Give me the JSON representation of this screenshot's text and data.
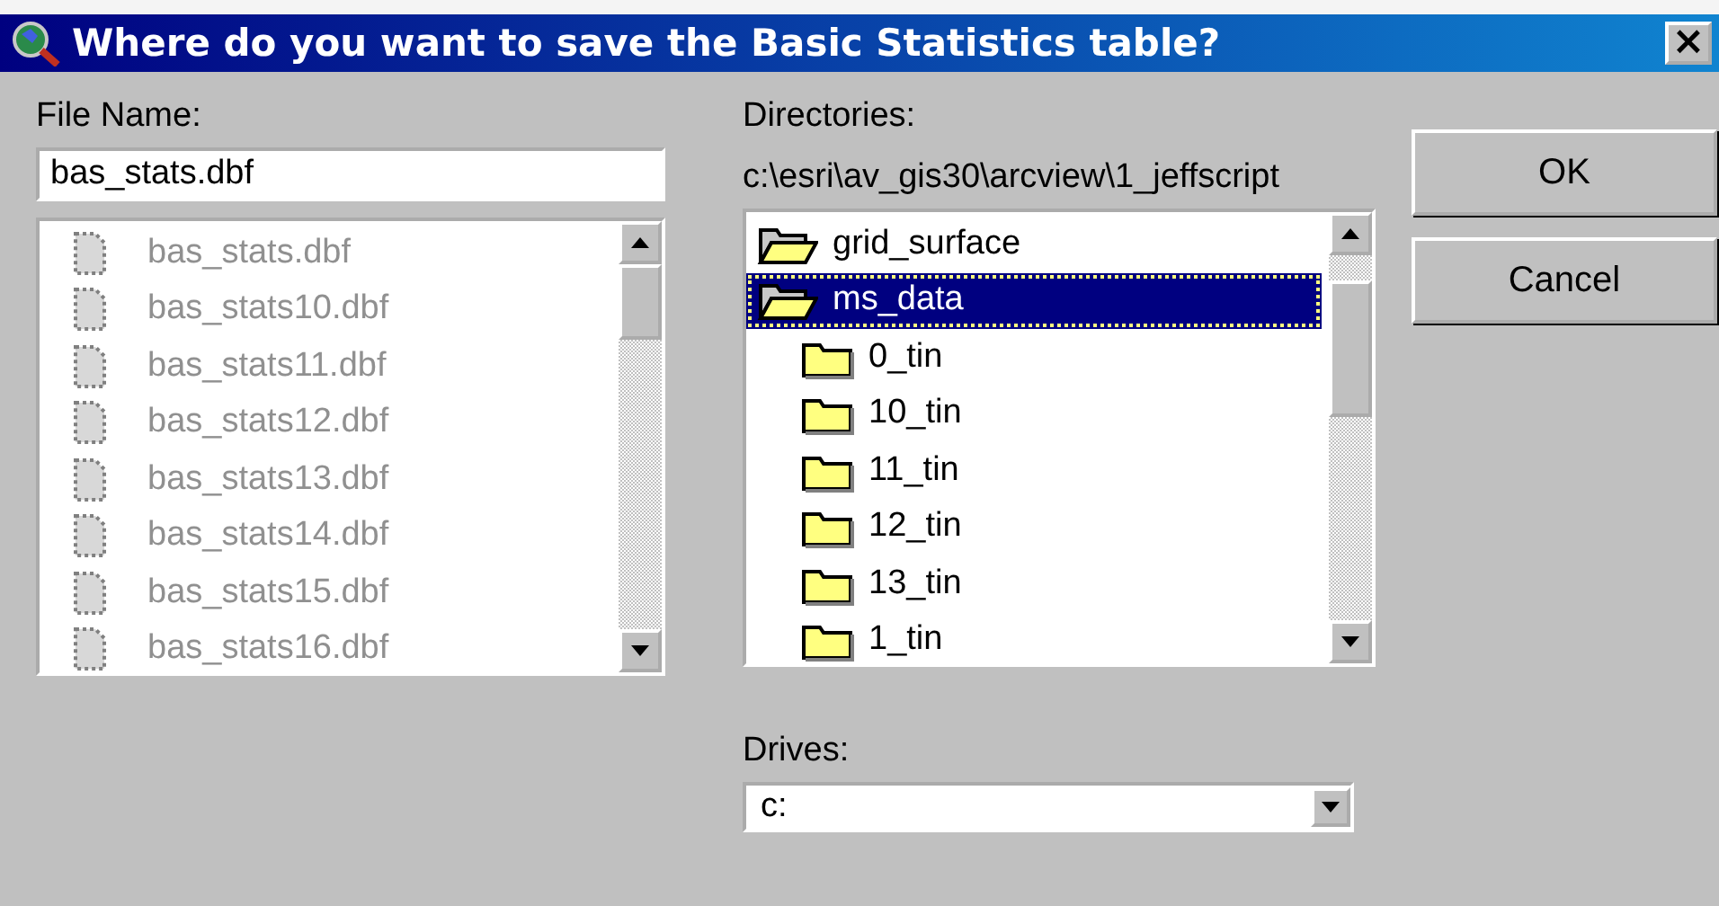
{
  "window": {
    "title": "Where do you want to save the Basic Statistics table?",
    "close": "×"
  },
  "file_name": {
    "label": "File Name:",
    "value": "bas_stats.dbf"
  },
  "files": [
    {
      "name": "bas_stats.dbf",
      "disabled": true
    },
    {
      "name": "bas_stats10.dbf",
      "disabled": true
    },
    {
      "name": "bas_stats11.dbf",
      "disabled": true
    },
    {
      "name": "bas_stats12.dbf",
      "disabled": true
    },
    {
      "name": "bas_stats13.dbf",
      "disabled": true
    },
    {
      "name": "bas_stats14.dbf",
      "disabled": true
    },
    {
      "name": "bas_stats15.dbf",
      "disabled": true
    },
    {
      "name": "bas_stats16.dbf",
      "disabled": true
    }
  ],
  "directories": {
    "label": "Directories:",
    "path": "c:\\esri\\av_gis30\\arcview\\1_jeffscript",
    "items": [
      {
        "name": "grid_surface",
        "expanded": true,
        "selected": false
      },
      {
        "name": "ms_data",
        "expanded": true,
        "selected": true,
        "children": [
          {
            "name": "0_tin",
            "expanded": false,
            "selected": false
          },
          {
            "name": "10_tin",
            "expanded": false,
            "selected": false
          },
          {
            "name": "11_tin",
            "expanded": false,
            "selected": false
          },
          {
            "name": "12_tin",
            "expanded": false,
            "selected": false
          },
          {
            "name": "13_tin",
            "expanded": false,
            "selected": false
          },
          {
            "name": "1_tin",
            "expanded": false,
            "selected": false
          }
        ]
      }
    ]
  },
  "drives": {
    "label": "Drives:",
    "value": "c:"
  },
  "buttons": [
    {
      "label": "OK"
    },
    {
      "label": "Cancel"
    }
  ]
}
